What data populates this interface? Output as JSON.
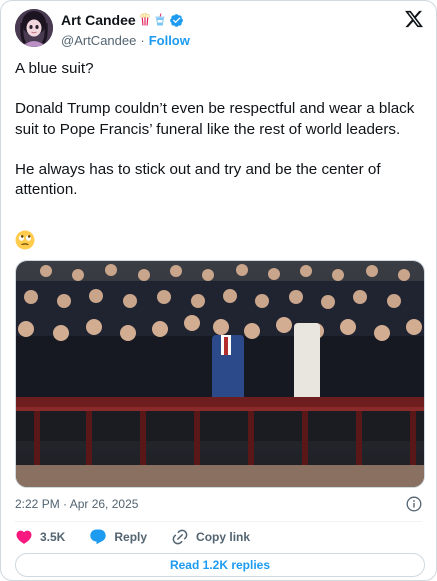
{
  "author": {
    "display_name": "Art Candee",
    "badges": [
      "popcorn-emoji",
      "drink-emoji"
    ],
    "handle": "@ArtCandee",
    "separator": "·",
    "follow_label": "Follow"
  },
  "tweet": {
    "paragraphs": [
      "A blue suit?",
      "Donald Trump couldn’t even be respectful and wear a black suit to Pope Francis’ funeral like the rest of world leaders.",
      "He always has to stick out and try and be the center of attention."
    ],
    "emoji": "rolling-eyes"
  },
  "media": {
    "type": "photo"
  },
  "meta": {
    "timestamp": "2:22 PM · Apr 26, 2025"
  },
  "actions": {
    "like_count": "3.5K",
    "reply_label": "Reply",
    "copy_link_label": "Copy link"
  },
  "read_replies_label": "Read 1.2K replies",
  "colors": {
    "accent": "#1d9bf0",
    "like": "#f91880",
    "text": "#0f1419",
    "secondary": "#536471",
    "border": "#cfd9de"
  }
}
